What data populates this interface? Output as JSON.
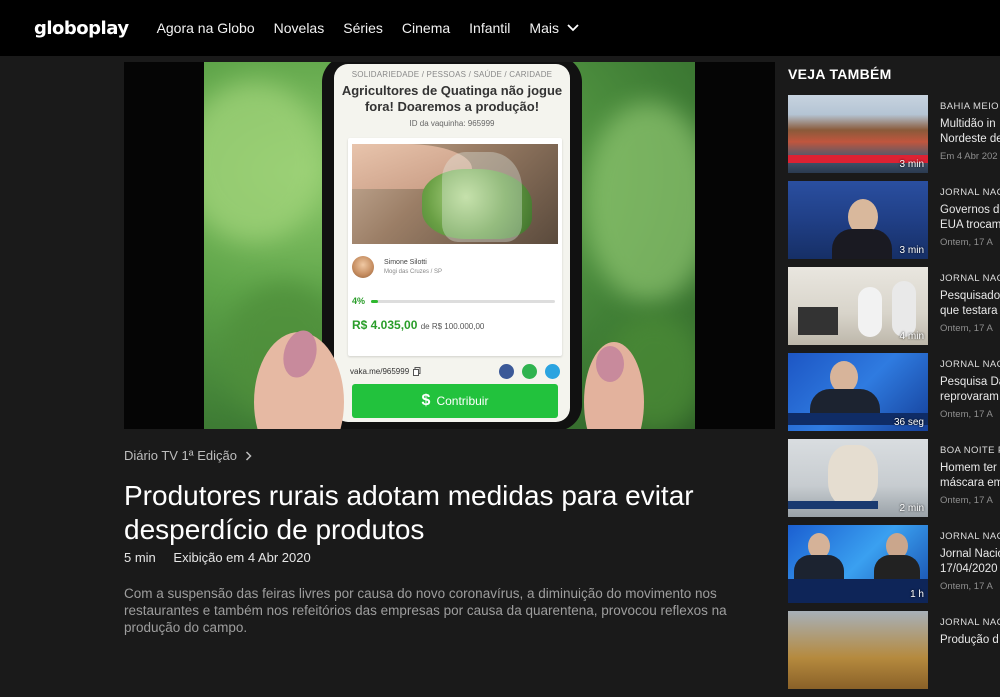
{
  "header": {
    "logo": "globoplay",
    "nav": [
      "Agora na Globo",
      "Novelas",
      "Séries",
      "Cinema",
      "Infantil"
    ],
    "more_label": "Mais"
  },
  "player": {
    "screen": {
      "categories": "SOLIDARIEDADE / PESSOAS / SAÚDE / CARIDADE",
      "title": "Agricultores de Quatinga não jogue fora! Doaremos a produção!",
      "id_text": "ID da vaquinha: 965999",
      "author_name": "Simone Silotti",
      "author_location": "Mogi das Cruzes / SP",
      "progress_pct": "4%",
      "progress_value": 0.04,
      "amount": "R$ 4.035,00",
      "amount_of": "de R$ 100.000,00",
      "link": "vaka.me/965999",
      "cta_symbol": "$",
      "cta": "Contribuir"
    }
  },
  "video": {
    "program": "Diário TV 1ª Edição",
    "title": "Produtores rurais adotam medidas para evitar desperdício de produtos",
    "duration": "5 min",
    "aired": "Exibição em 4 Abr 2020",
    "description": "Com a suspensão das feiras livres por causa do novo coronavírus, a diminuição do movimento nos restaurantes e também nos refeitórios das empresas por causa da quarentena, provocou reflexos na produção do campo."
  },
  "sidebar": {
    "heading": "VEJA TAMBÉM",
    "items": [
      {
        "program": "BAHIA MEIO",
        "text": "Multidão in",
        "text2": "Nordeste de",
        "date": "Em 4 Abr 202",
        "duration": "3 min"
      },
      {
        "program": "JORNAL NAC",
        "text": "Governos d",
        "text2": "EUA trocam",
        "date": "Ontem, 17 A",
        "duration": "3 min"
      },
      {
        "program": "JORNAL NAC",
        "text": "Pesquisado",
        "text2": "que testara",
        "date": "Ontem, 17 A",
        "duration": "4 min"
      },
      {
        "program": "JORNAL NAC",
        "text": "Pesquisa Da",
        "text2": "reprovaram",
        "date": "Ontem, 17 A",
        "duration": "36 seg"
      },
      {
        "program": "BOA NOITE P",
        "text": "Homem ter",
        "text2": "máscara em",
        "date": "Ontem, 17 A",
        "duration": "2 min"
      },
      {
        "program": "JORNAL NAC",
        "text": "Jornal Nacio",
        "text2": "17/04/2020",
        "date": "Ontem, 17 A",
        "duration": "1 h"
      },
      {
        "program": "JORNAL NAC",
        "text": "Produção d",
        "text2": "",
        "date": "",
        "duration": ""
      }
    ]
  },
  "colors": {
    "header_bg": "#000000",
    "page_bg": "#1a1a1a",
    "cta_green": "#22c23d"
  }
}
